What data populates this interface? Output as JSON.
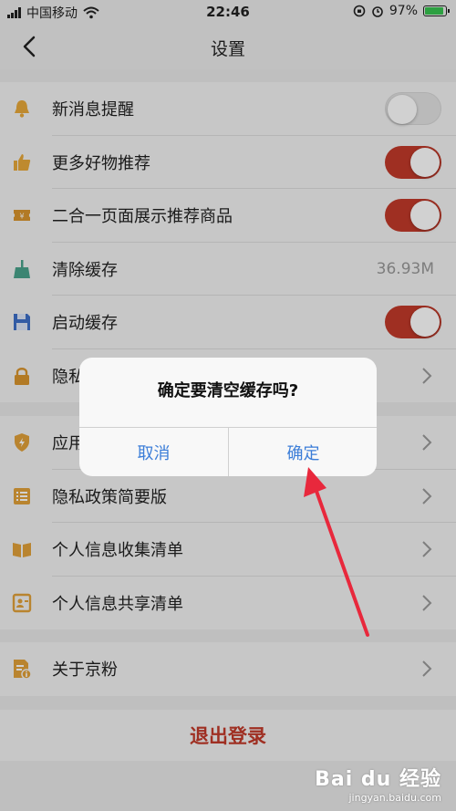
{
  "status_bar": {
    "carrier": "中国移动",
    "time": "22:46",
    "battery": "97%"
  },
  "nav": {
    "title": "设置"
  },
  "group1": [
    {
      "label": "新消息提醒",
      "icon": "bell-icon",
      "control": "toggle",
      "on": false
    },
    {
      "label": "更多好物推荐",
      "icon": "thumbs-up-icon",
      "control": "toggle",
      "on": true
    },
    {
      "label": "二合一页面展示推荐商品",
      "icon": "coupon-icon",
      "control": "toggle",
      "on": true
    },
    {
      "label": "清除缓存",
      "icon": "broom-icon",
      "control": "value",
      "value": "36.93M"
    },
    {
      "label": "启动缓存",
      "icon": "save-icon",
      "control": "toggle",
      "on": true
    },
    {
      "label": "隐私",
      "icon": "lock-icon",
      "control": "chevron"
    }
  ],
  "group2": [
    {
      "label": "应用",
      "icon": "shield-icon",
      "control": "chevron"
    },
    {
      "label": "隐私政策简要版",
      "icon": "list-icon",
      "control": "chevron"
    },
    {
      "label": "个人信息收集清单",
      "icon": "book-icon",
      "control": "chevron"
    },
    {
      "label": "个人信息共享清单",
      "icon": "share-doc-icon",
      "control": "chevron"
    }
  ],
  "group3": [
    {
      "label": "关于京粉",
      "icon": "info-doc-icon",
      "control": "chevron"
    }
  ],
  "logout_label": "退出登录",
  "dialog": {
    "title": "确定要清空缓存吗?",
    "cancel_label": "取消",
    "confirm_label": "确定"
  },
  "watermark": {
    "logo": "Bai du 经验",
    "url": "jingyan.baidu.com"
  },
  "colors": {
    "accent_red": "#c23a2a",
    "dialog_button_blue": "#3b7dd8",
    "arrow_red": "#e8283c"
  }
}
